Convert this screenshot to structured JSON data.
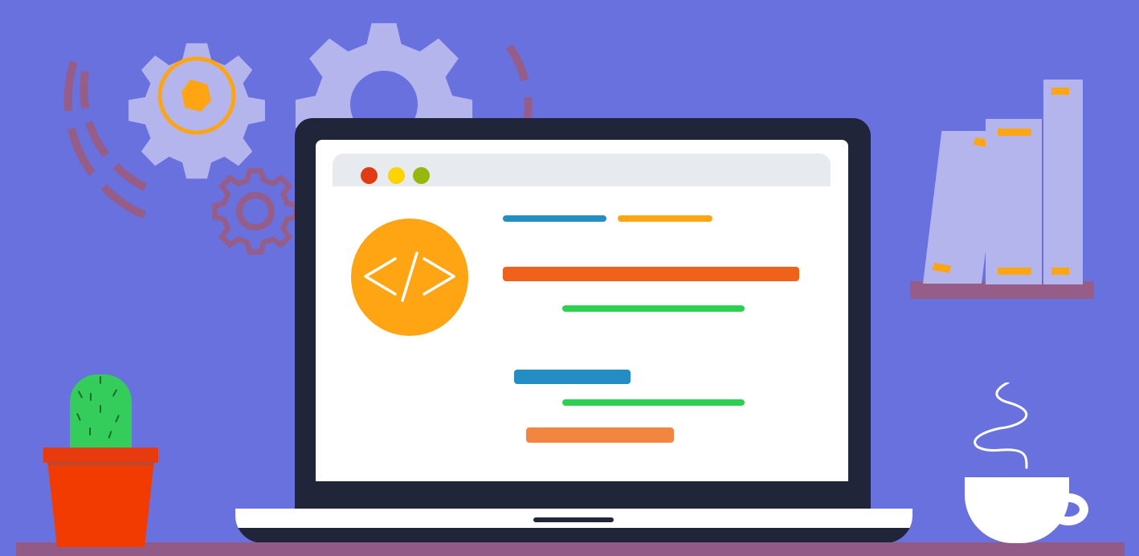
{
  "scene": {
    "code_badge_text": "</>",
    "colors": {
      "background": "#6871de",
      "laptop_frame": "#21253a",
      "screen": "#ffffff",
      "orange": "#ffa413",
      "blue": "#248dc4",
      "red_orange": "#f0621b",
      "green": "#2ed052",
      "light_orange": "#f28640",
      "window_red": "#e13b13",
      "window_yellow": "#ffd300",
      "window_olive": "#98b70d",
      "shelf": "#965d88",
      "book": "#b4b5ed",
      "plant_pot": "#f23b00",
      "cactus": "#34cc5a",
      "cup": "#ffffff"
    },
    "icons": [
      "gear-icon",
      "code-icon",
      "book-icon",
      "cactus-icon",
      "coffee-cup-icon"
    ]
  }
}
